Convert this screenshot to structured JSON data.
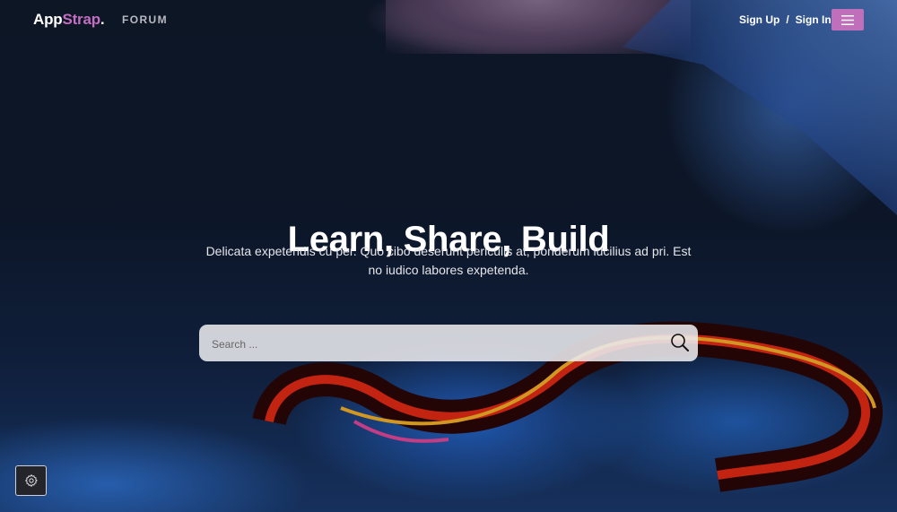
{
  "brand": {
    "logo_main": "App",
    "logo_accent": "Strap",
    "logo_dot": ".",
    "accent_color": "#c36ec1"
  },
  "nav": {
    "forum_label": "FORUM",
    "sign_up_label": "Sign Up",
    "separator": "/",
    "sign_in_label": "Sign In",
    "menu_icon": "hamburger-menu-icon",
    "menu_button_color": "#c06fba"
  },
  "hero": {
    "title": "Learn, Share, Build",
    "subtitle": "Delicata expetendis cu per. Quo cibo deserunt periculis at, ponderum lucilius ad pri. Est no iudico labores expetenda."
  },
  "search": {
    "placeholder": "Search ...",
    "value": "",
    "icon": "search-icon"
  },
  "settings": {
    "icon": "gear-icon"
  }
}
